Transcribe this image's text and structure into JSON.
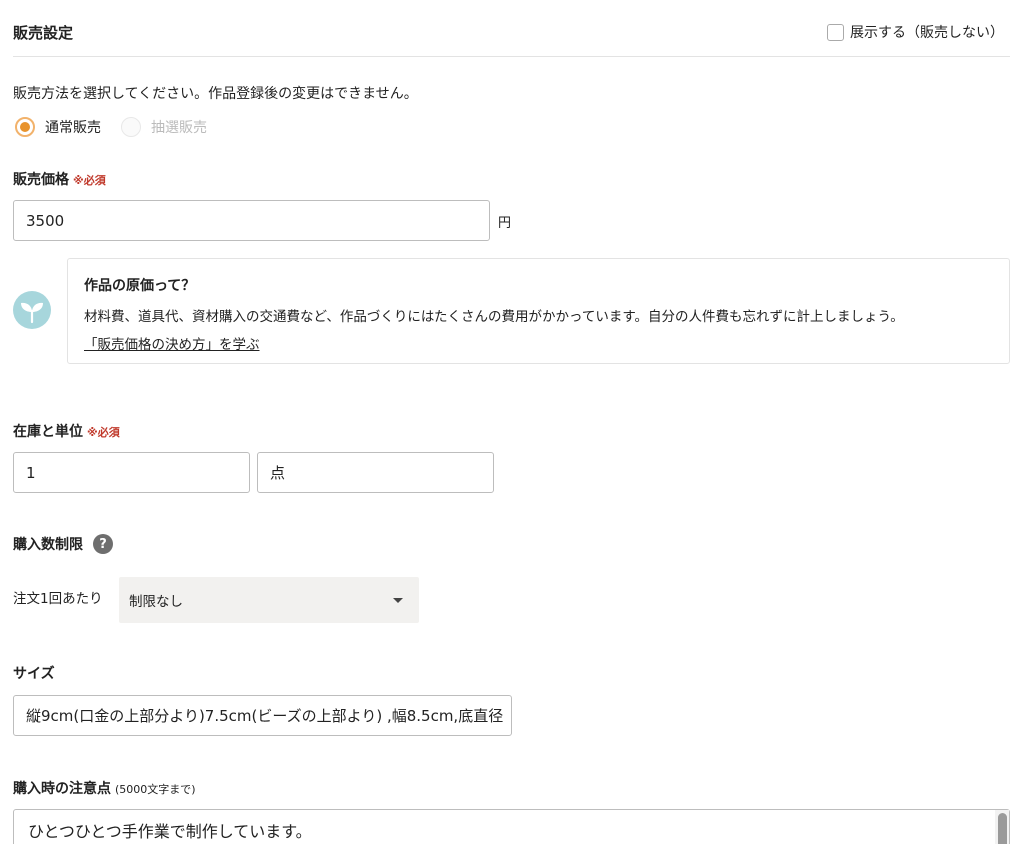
{
  "header": {
    "title": "販売設定",
    "hide_label": "展示する（販売しない）"
  },
  "sales_method": {
    "instruction": "販売方法を選択してください。作品登録後の変更はできません。",
    "options": [
      {
        "label": "通常販売",
        "checked": true
      },
      {
        "label": "抽選販売",
        "disabled": true
      }
    ]
  },
  "price": {
    "label": "販売価格",
    "required": "※必須",
    "value": "3500",
    "unit": "円"
  },
  "tip": {
    "icon": "sprout-icon",
    "title": "作品の原価って？",
    "body": "材料費、道具代、資材購入の交通費など、作品づくりにはたくさんの費用がかかっています。自分の人件費も忘れずに計上しましょう。",
    "link": "「販売価格の決め方」を学ぶ"
  },
  "stock": {
    "label": "在庫と単位",
    "required": "※必須",
    "quantity": "1",
    "unit": "点"
  },
  "purchase_limit": {
    "label": "購入数制限",
    "help_icon": "?",
    "per_order_label": "注文1回あたり",
    "selected": "制限なし"
  },
  "size": {
    "label": "サイズ",
    "value": "縦9cm(口金の上部分より)7.5cm(ビーズの上部より) ,幅8.5cm,底直径"
  },
  "notes": {
    "label": "購入時の注意点",
    "hint": "(5000文字まで)",
    "value": "ひとつひとつ手作業で制作しています。"
  }
}
